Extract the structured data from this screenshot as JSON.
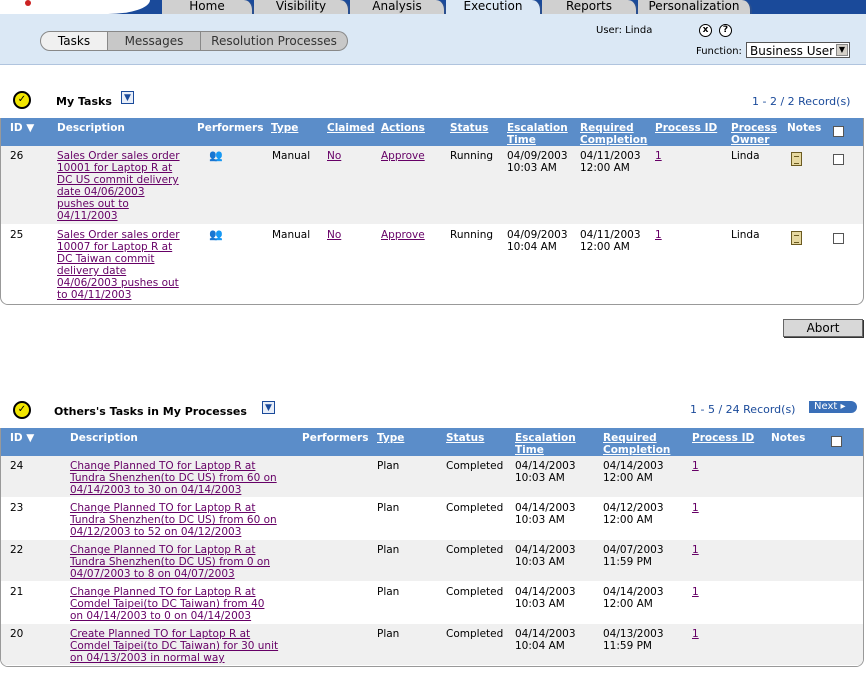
{
  "top_tabs": [
    "Home",
    "Visibility",
    "Analysis",
    "Execution",
    "Reports",
    "Personalization"
  ],
  "active_tab": "Execution",
  "sub_tabs": [
    "Tasks",
    "Messages",
    "Resolution Processes"
  ],
  "user_label": "User: Linda",
  "function_label": "Function:",
  "function_value": "Business User",
  "my_tasks": {
    "title": "My Tasks",
    "records": "1 - 2 / 2 Record(s)",
    "headers": {
      "id": "ID",
      "description": "Description",
      "performers": "Performers",
      "type": "Type",
      "claimed": "Claimed",
      "actions": "Actions",
      "status": "Status",
      "escalation": "Escalation Time",
      "required": "Required Completion",
      "process_id": "Process ID",
      "owner": "Process Owner",
      "notes": "Notes"
    },
    "rows": [
      {
        "id": "26",
        "desc": [
          "Sales Order sales order",
          "10001 for Laptop R at",
          "DC US commit delivery",
          "date 04/06/2003",
          "pushes out to",
          "04/11/2003"
        ],
        "type": "Manual",
        "claimed": "No",
        "action": "Approve",
        "status": "Running",
        "esc_date": "04/09/2003",
        "esc_time": "10:03 AM",
        "req_date": "04/11/2003",
        "req_time": "12:00 AM",
        "process_id": "1",
        "owner": "Linda"
      },
      {
        "id": "25",
        "desc": [
          "Sales Order sales order",
          "10007 for Laptop R at",
          "DC Taiwan commit",
          "delivery date",
          "04/06/2003 pushes out",
          "to 04/11/2003"
        ],
        "type": "Manual",
        "claimed": "No",
        "action": "Approve",
        "status": "Running",
        "esc_date": "04/09/2003",
        "esc_time": "10:04 AM",
        "req_date": "04/11/2003",
        "req_time": "12:00 AM",
        "process_id": "1",
        "owner": "Linda"
      }
    ],
    "abort_label": "Abort"
  },
  "others_tasks": {
    "title": "Others's Tasks in My Processes",
    "records": "1 - 5 / 24 Record(s)",
    "next_label": "Next",
    "headers": {
      "id": "ID",
      "description": "Description",
      "performers": "Performers",
      "type": "Type",
      "status": "Status",
      "escalation": "Escalation Time",
      "required": "Required Completion",
      "process_id": "Process ID",
      "notes": "Notes"
    },
    "rows": [
      {
        "id": "24",
        "desc": [
          "Change Planned TO for Laptop R at",
          "Tundra Shenzhen(to DC US) from 60 on",
          "04/14/2003 to 30 on 04/14/2003"
        ],
        "type": "Plan",
        "status": "Completed",
        "esc_date": "04/14/2003",
        "esc_time": "10:03 AM",
        "req_date": "04/14/2003",
        "req_time": "12:00 AM",
        "process_id": "1"
      },
      {
        "id": "23",
        "desc": [
          "Change Planned TO for Laptop R at",
          "Tundra Shenzhen(to DC US) from 60 on",
          "04/12/2003 to 52 on 04/12/2003"
        ],
        "type": "Plan",
        "status": "Completed",
        "esc_date": "04/14/2003",
        "esc_time": "10:03 AM",
        "req_date": "04/12/2003",
        "req_time": "12:00 AM",
        "process_id": "1"
      },
      {
        "id": "22",
        "desc": [
          "Change Planned TO for Laptop R at",
          "Tundra Shenzhen(to DC US) from 0 on",
          "04/07/2003 to 8 on 04/07/2003"
        ],
        "type": "Plan",
        "status": "Completed",
        "esc_date": "04/14/2003",
        "esc_time": "10:03 AM",
        "req_date": "04/07/2003",
        "req_time": "11:59 PM",
        "process_id": "1"
      },
      {
        "id": "21",
        "desc": [
          "Change Planned TO for Laptop R at",
          "Comdel Taipei(to DC Taiwan) from 40",
          "on 04/14/2003 to 0 on 04/14/2003"
        ],
        "type": "Plan",
        "status": "Completed",
        "esc_date": "04/14/2003",
        "esc_time": "10:03 AM",
        "req_date": "04/14/2003",
        "req_time": "12:00 AM",
        "process_id": "1"
      },
      {
        "id": "20",
        "desc": [
          "Create Planned TO for Laptop R at",
          "Comdel Taipei(to DC Taiwan) for 30 unit",
          "on 04/13/2003 in normal way"
        ],
        "type": "Plan",
        "status": "Completed",
        "esc_date": "04/14/2003",
        "esc_time": "10:04 AM",
        "req_date": "04/13/2003",
        "req_time": "11:59 PM",
        "process_id": "1"
      }
    ]
  }
}
